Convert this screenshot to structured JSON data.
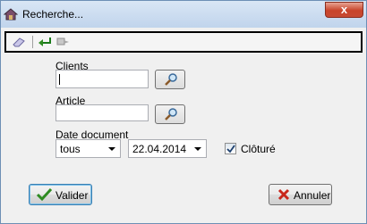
{
  "window": {
    "title": "Recherche...",
    "close_label": "x"
  },
  "form": {
    "clients_label": "Clients",
    "clients_value": "",
    "article_label": "Article",
    "article_value": "",
    "date_label": "Date document",
    "date_mode": "tous",
    "date_value": "22.04.2014",
    "cloture_label": "Clôturé",
    "cloture_checked": true
  },
  "buttons": {
    "valider": "Valider",
    "annuler": "Annuler"
  },
  "icons": {
    "app": "house-icon",
    "eraser": "eraser-icon",
    "back": "green-back-arrow-icon",
    "forward": "gray-forward-arrow-icon",
    "search": "magnifier-icon",
    "check": "green-checkmark-icon",
    "cancel": "red-x-icon"
  },
  "colors": {
    "accent_green": "#2e8b22",
    "cancel_red": "#c8261b",
    "close_red": "#c8442a"
  }
}
